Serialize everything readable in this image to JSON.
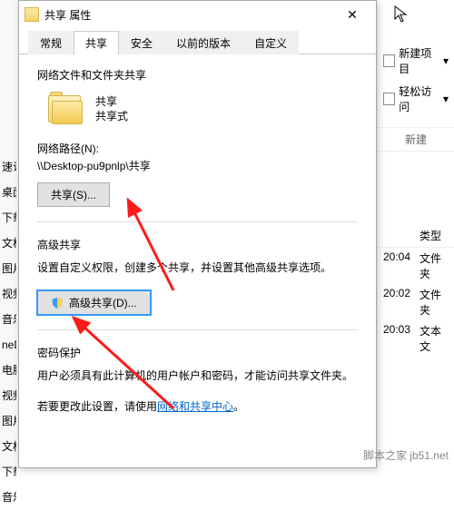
{
  "dialog": {
    "title": "共享 属性",
    "close": "✕",
    "tabs": [
      "常规",
      "共享",
      "安全",
      "以前的版本",
      "自定义"
    ],
    "active_tab": 1,
    "section_fileshare": "网络文件和文件夹共享",
    "folder_name": "共享",
    "folder_status": "共享式",
    "net_path_label": "网络路径(N):",
    "net_path": "\\\\Desktop-pu9pnlp\\共享",
    "btn_share": "共享(S)...",
    "section_advanced": "高级共享",
    "advanced_desc": "设置自定义权限，创建多个共享，并设置其他高级共享选项。",
    "btn_advanced": "高级共享(D)...",
    "section_password": "密码保护",
    "password_desc1": "用户必须具有此计算机的用户帐户和密码，才能访问共享文件夹。",
    "password_desc2_pre": "若要更改此设置，请使用",
    "password_link": "网络和共享中心",
    "password_desc2_post": "。"
  },
  "ribbon": {
    "new_item": "新建项目",
    "easy_access": "轻松访问",
    "group_label": "新建"
  },
  "files": {
    "header_type": "类型",
    "rows": [
      {
        "time": "20:04",
        "type": "文件夹"
      },
      {
        "time": "20:02",
        "type": "文件夹"
      },
      {
        "time": "20:03",
        "type": "文本文"
      }
    ]
  },
  "sidebar": [
    "速访",
    "桌面",
    "下载",
    "文档",
    "图片",
    "视频",
    "音乐",
    "neD",
    "电脑",
    "视频",
    "图片",
    "文档",
    "下载",
    "音乐"
  ],
  "watermark": "脚本之家 jb51.net"
}
